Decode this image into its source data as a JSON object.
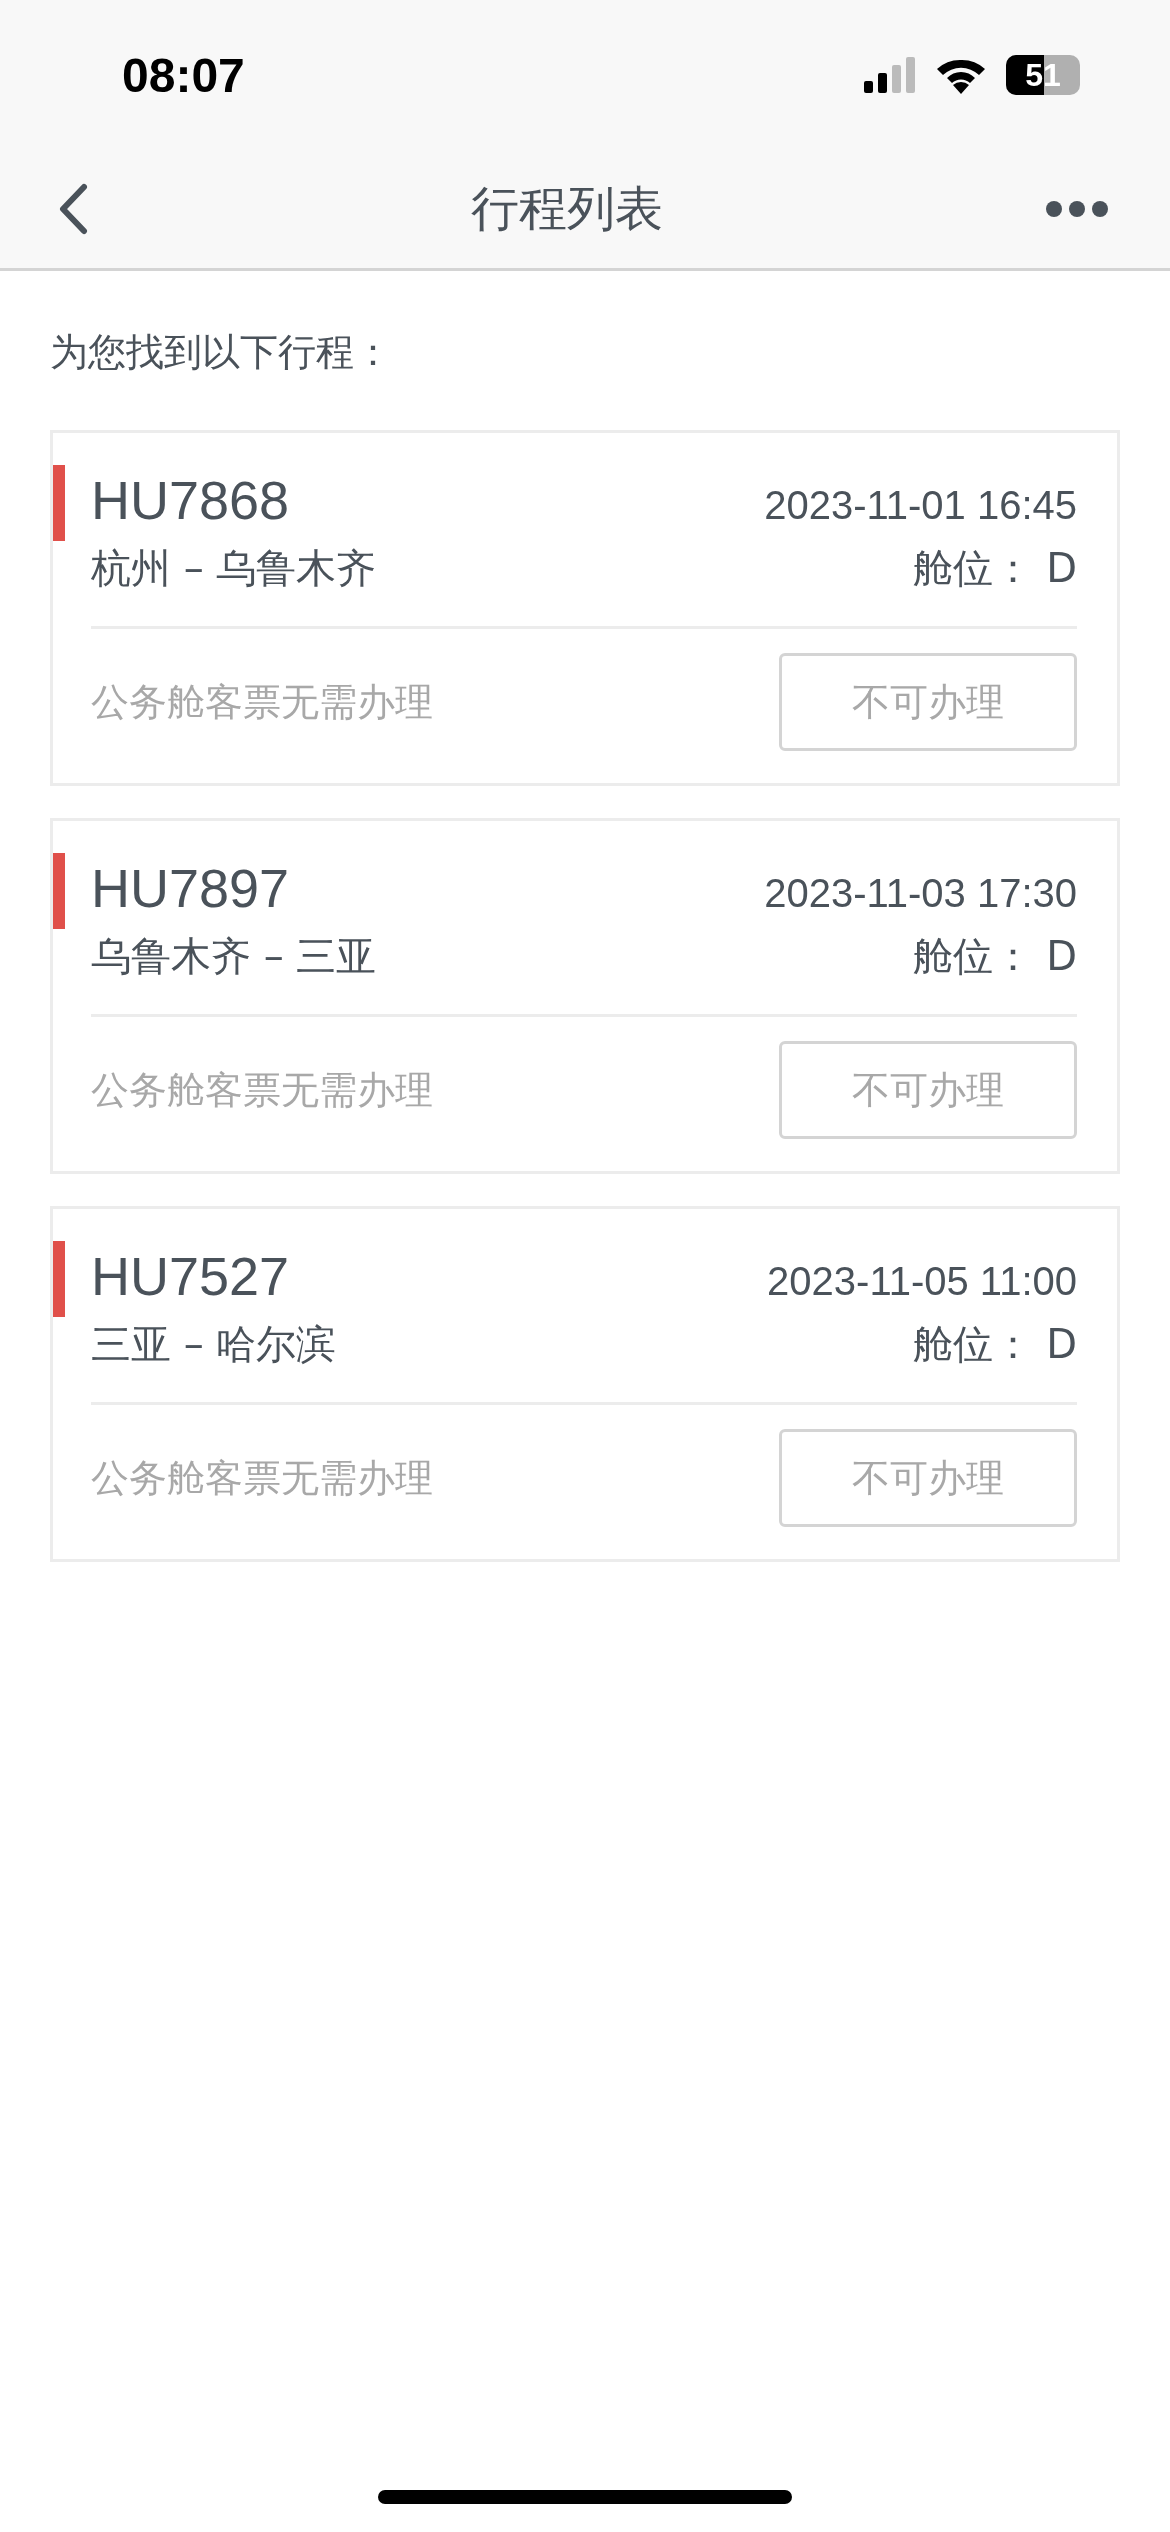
{
  "status_bar": {
    "time": "08:07",
    "battery": "51"
  },
  "nav": {
    "title": "行程列表"
  },
  "intro": "为您找到以下行程：",
  "trips": [
    {
      "flight": "HU7868",
      "datetime": "2023-11-01 16:45",
      "route": "杭州 – 乌鲁木齐",
      "cabin": "舱位： D",
      "note": "公务舱客票无需办理",
      "button": {
        "label": "不可办理",
        "disabled": true
      }
    },
    {
      "flight": "HU7897",
      "datetime": "2023-11-03 17:30",
      "route": "乌鲁木齐 – 三亚",
      "cabin": "舱位： D",
      "note": "公务舱客票无需办理",
      "button": {
        "label": "不可办理",
        "disabled": true
      }
    },
    {
      "flight": "HU7527",
      "datetime": "2023-11-05 11:00",
      "route": "三亚 – 哈尔滨",
      "cabin": "舱位： D",
      "note": "公务舱客票无需办理",
      "button": {
        "label": "不可办理",
        "disabled": true
      }
    }
  ]
}
